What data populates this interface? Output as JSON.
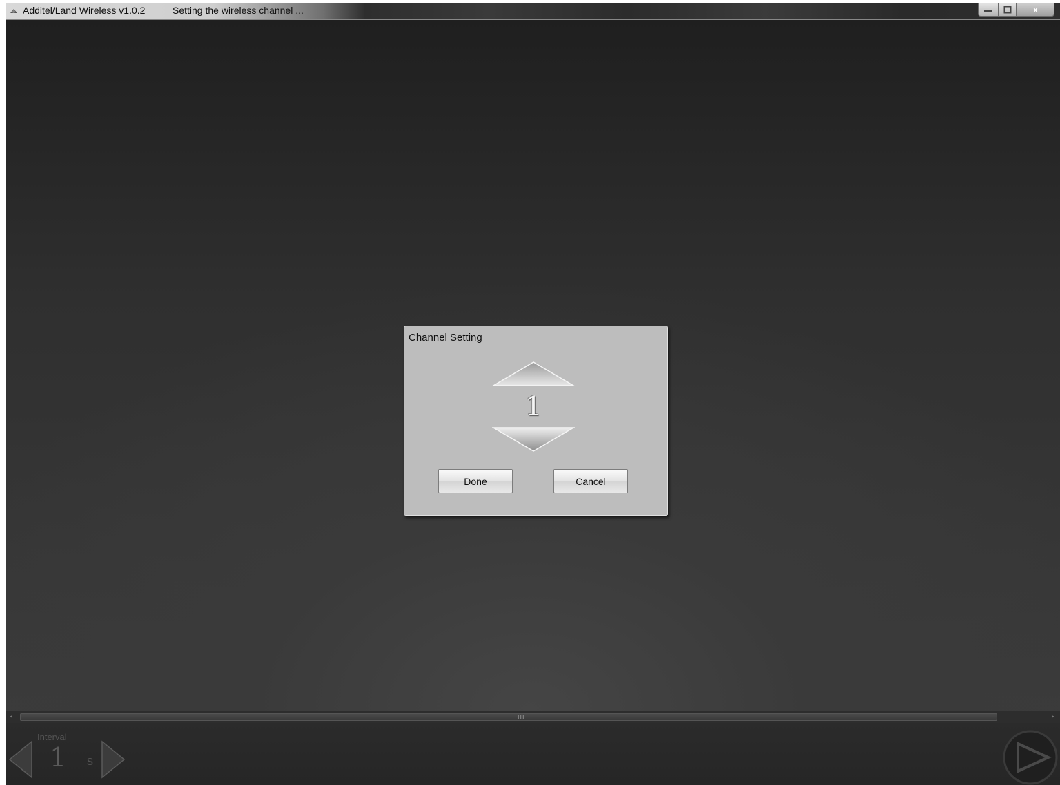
{
  "window": {
    "app_title": "Additel/Land Wireless v1.0.2",
    "document_title": "Setting the wireless channel ...",
    "minimize_icon": "minimize-icon",
    "maximize_icon": "maximize-icon",
    "close_glyph": "x"
  },
  "dialog": {
    "title": "Channel Setting",
    "channel_value": "1",
    "up_icon": "triangle-up-icon",
    "down_icon": "triangle-down-icon",
    "done_label": "Done",
    "cancel_label": "Cancel"
  },
  "scrollbar": {
    "grip": "III"
  },
  "bottom": {
    "interval_label": "Interval",
    "interval_value": "1",
    "interval_unit": "s",
    "decrease_icon": "triangle-left-icon",
    "increase_icon": "triangle-right-icon",
    "go_icon": "start-icon"
  },
  "colors": {
    "background": "#2a2a2a",
    "dialog_bg": "#bdbdbd",
    "button_bg": "#e6e6e6"
  }
}
